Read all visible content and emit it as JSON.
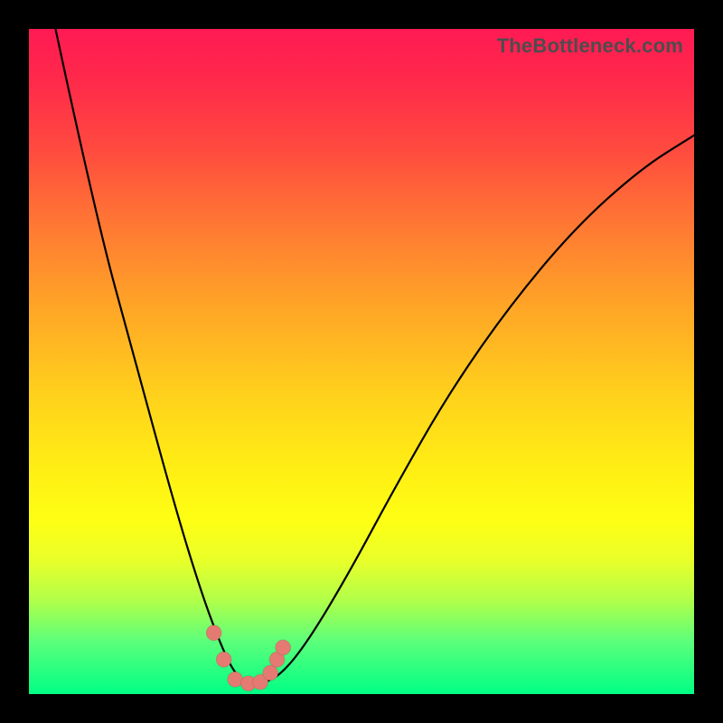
{
  "watermark": "TheBottleneck.com",
  "chart_data": {
    "type": "line",
    "title": "",
    "xlabel": "",
    "ylabel": "",
    "xlim": [
      0,
      100
    ],
    "ylim": [
      0,
      100
    ],
    "grid": false,
    "legend": false,
    "series": [
      {
        "name": "bottleneck-curve",
        "x": [
          4,
          10,
          16,
          22,
          26,
          29,
          31,
          33,
          35,
          38,
          42,
          48,
          55,
          63,
          72,
          82,
          92,
          100
        ],
        "y": [
          100,
          72,
          50,
          28,
          15,
          7,
          3,
          1.5,
          1.5,
          3,
          8,
          18,
          31,
          45,
          58,
          70,
          79,
          84
        ]
      }
    ],
    "markers": {
      "name": "sample-points",
      "x": [
        27.8,
        29.3,
        31.0,
        33.0,
        34.8,
        36.3,
        37.3,
        38.2
      ],
      "y": [
        9.2,
        5.2,
        2.2,
        1.6,
        1.8,
        3.2,
        5.2,
        7.0
      ]
    },
    "background_gradient": {
      "top": "#ff1a54",
      "mid": "#ffee14",
      "bottom": "#00ff85"
    }
  }
}
